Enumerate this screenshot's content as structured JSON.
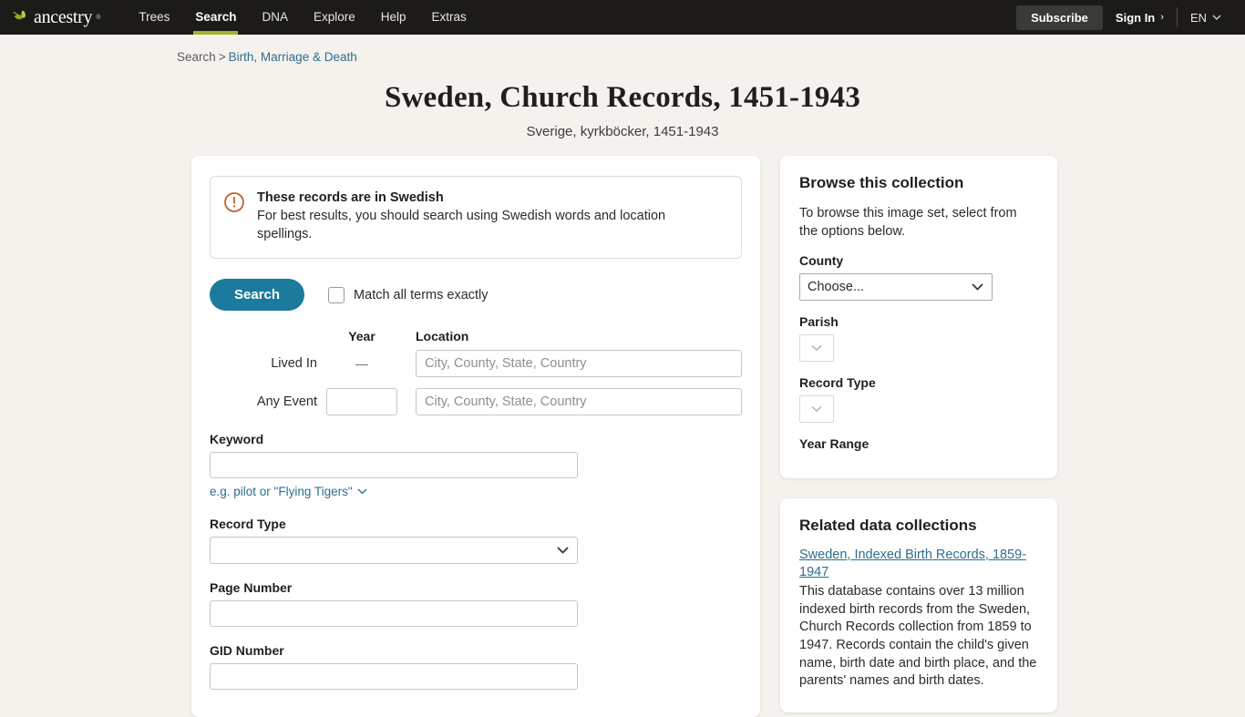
{
  "header": {
    "logo_text": "ancestry",
    "logo_tm": "®",
    "nav": [
      {
        "label": "Trees",
        "active": false
      },
      {
        "label": "Search",
        "active": true
      },
      {
        "label": "DNA",
        "active": false
      },
      {
        "label": "Explore",
        "active": false
      },
      {
        "label": "Help",
        "active": false
      },
      {
        "label": "Extras",
        "active": false
      }
    ],
    "subscribe_label": "Subscribe",
    "signin_label": "Sign In",
    "signin_chevron": "›",
    "language_label": "EN",
    "language_chevron": "⌄",
    "accent_green": "#9db72b",
    "bar_color": "#1c1b17"
  },
  "breadcrumb": {
    "root": "Search",
    "separator": ">",
    "current": "Birth, Marriage & Death"
  },
  "title": "Sweden, Church Records, 1451-1943",
  "subtitle": "Sverige, kyrkböcker, 1451-1943",
  "alert": {
    "icon": "exclamation-circle-icon",
    "icon_color": "#c0622b",
    "title": "These records are in Swedish",
    "body": "For best results, you should search using Swedish words and location spellings."
  },
  "search": {
    "button_label": "Search",
    "button_color": "#1c7b9c",
    "match_exactly_label": "Match all terms exactly",
    "match_exactly_checked": false
  },
  "location_table": {
    "headers": {
      "blank": "",
      "year": "Year",
      "location": "Location"
    },
    "rows": [
      {
        "label": "Lived In",
        "year_value": "",
        "year_display": "—",
        "year_is_input": false,
        "location_value": "",
        "location_placeholder": "City, County, State, Country"
      },
      {
        "label": "Any Event",
        "year_value": "",
        "year_display": "",
        "year_is_input": true,
        "location_value": "",
        "location_placeholder": "City, County, State, Country"
      }
    ]
  },
  "fields": {
    "keyword": {
      "label": "Keyword",
      "value": "",
      "placeholder": "",
      "hint": "e.g. pilot or \"Flying Tigers\"",
      "hint_chevron": "⌄"
    },
    "record_type": {
      "label": "Record Type",
      "selected": "",
      "options": [
        ""
      ]
    },
    "page_number": {
      "label": "Page Number",
      "value": "",
      "placeholder": ""
    },
    "gid_number": {
      "label": "GID Number",
      "value": "",
      "placeholder": ""
    }
  },
  "browse_panel": {
    "title": "Browse this collection",
    "description": "To browse this image set, select from the options below.",
    "county": {
      "label": "County",
      "selected": "Choose...",
      "options": [
        "Choose..."
      ]
    },
    "parish": {
      "label": "Parish",
      "selected": "",
      "options": [
        ""
      ],
      "disabled": true
    },
    "record_type": {
      "label": "Record Type",
      "selected": "",
      "options": [
        ""
      ],
      "disabled": true
    },
    "year_range": {
      "label": "Year Range"
    }
  },
  "related_panel": {
    "title": "Related data collections",
    "items": [
      {
        "link": "Sweden, Indexed Birth Records, 1859-1947",
        "description": "This database contains over 13 million indexed birth records from the Sweden, Church Records collection from 1859 to 1947. Records contain the child's given name, birth date and birth place, and the parents' names and birth dates."
      }
    ]
  }
}
